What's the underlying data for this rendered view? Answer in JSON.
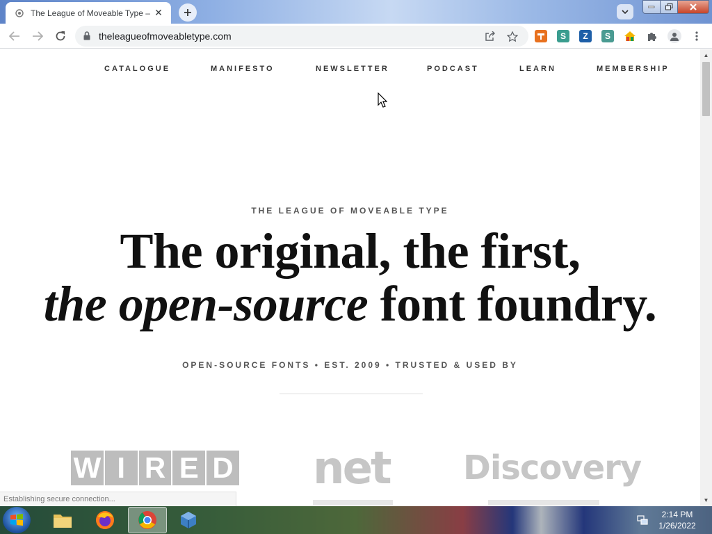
{
  "browser": {
    "tab_title": "The League of Moveable Type – ",
    "url": "theleagueofmoveabletype.com",
    "status_text": "Establishing secure connection..."
  },
  "site": {
    "nav": [
      "CATALOGUE",
      "MANIFESTO",
      "NEWSLETTER",
      "PODCAST",
      "LEARN",
      "MEMBERSHIP"
    ],
    "eyebrow": "THE LEAGUE OF MOVEABLE TYPE",
    "headline_line1": "The original, the first,",
    "headline_line2_italic": "the open-source",
    "headline_line2_rest": " font foundry.",
    "subline": "OPEN-SOURCE FONTS • EST. 2009 • TRUSTED & USED BY",
    "logos": {
      "wired": [
        "W",
        "I",
        "R",
        "E",
        "D"
      ],
      "net": "net",
      "discovery": "Discovery"
    }
  },
  "taskbar": {
    "time": "2:14 PM",
    "date": "1/26/2022"
  },
  "colors": {
    "chrome_tab_bg": "#ffffff",
    "omnibox_bg": "#f1f3f4",
    "text_dark": "#111111",
    "text_muted": "#555555",
    "logo_gray": "#c6c6c6"
  },
  "icons": {
    "extensions": [
      "extension-orange-icon",
      "extension-s-green-icon",
      "extension-z-blue-icon",
      "extension-s-teal-icon",
      "extension-house-icon",
      "puzzle-icon"
    ]
  }
}
